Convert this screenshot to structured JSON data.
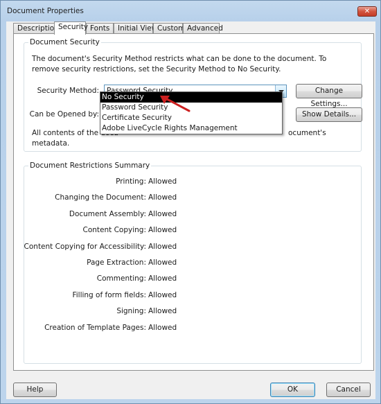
{
  "window": {
    "title": "Document Properties",
    "close_glyph": "✕"
  },
  "tabs": [
    {
      "label": "Description",
      "active": false
    },
    {
      "label": "Security",
      "active": true
    },
    {
      "label": "Fonts",
      "active": false
    },
    {
      "label": "Initial View",
      "active": false
    },
    {
      "label": "Custom",
      "active": false
    },
    {
      "label": "Advanced",
      "active": false
    }
  ],
  "document_security": {
    "group_title": "Document Security",
    "description": "The document's Security Method restricts what can be done to the document. To remove security restrictions, set the Security Method to No Security.",
    "security_method_label": "Security Method:",
    "security_method_value": "Password Security",
    "can_be_opened_label": "Can be Opened by:",
    "change_settings_label": "Change Settings...",
    "show_details_label": "Show Details...",
    "contents_text_prefix": "All contents of the docu",
    "contents_text_suffix": "ocument's",
    "contents_text_line2": "metadata.",
    "dropdown_options": [
      {
        "label": "No Security",
        "highlighted": true
      },
      {
        "label": "Password Security",
        "highlighted": false
      },
      {
        "label": "Certificate Security",
        "highlighted": false
      },
      {
        "label": "Adobe LiveCycle Rights Management",
        "highlighted": false
      }
    ]
  },
  "restrictions": {
    "group_title": "Document Restrictions Summary",
    "rows": [
      {
        "label": "Printing:",
        "value": "Allowed"
      },
      {
        "label": "Changing the Document:",
        "value": "Allowed"
      },
      {
        "label": "Document Assembly:",
        "value": "Allowed"
      },
      {
        "label": "Content Copying:",
        "value": "Allowed"
      },
      {
        "label": "Content Copying for Accessibility:",
        "value": "Allowed"
      },
      {
        "label": "Page Extraction:",
        "value": "Allowed"
      },
      {
        "label": "Commenting:",
        "value": "Allowed"
      },
      {
        "label": "Filling of form fields:",
        "value": "Allowed"
      },
      {
        "label": "Signing:",
        "value": "Allowed"
      },
      {
        "label": "Creation of Template Pages:",
        "value": "Allowed"
      }
    ]
  },
  "footer": {
    "help_label": "Help",
    "ok_label": "OK",
    "cancel_label": "Cancel"
  },
  "annotation": {
    "arrow_color": "#cc1f1f"
  }
}
